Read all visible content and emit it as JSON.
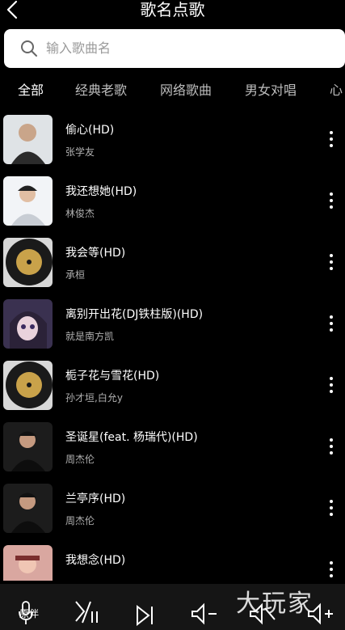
{
  "header": {
    "title": "歌名点歌"
  },
  "search": {
    "placeholder": "输入歌曲名"
  },
  "tabs": [
    {
      "label": "全部"
    },
    {
      "label": "经典老歌"
    },
    {
      "label": "网络歌曲"
    },
    {
      "label": "男女对唱"
    },
    {
      "label": "心"
    }
  ],
  "songs": [
    {
      "title": "偷心(HD)",
      "artist": "张学友",
      "thumb": "portrait-icon"
    },
    {
      "title": "我还想她(HD)",
      "artist": "林俊杰",
      "thumb": "portrait-icon"
    },
    {
      "title": "我会等(HD)",
      "artist": "承桓",
      "thumb": "vinyl-record-icon"
    },
    {
      "title": "离别开出花(DJ铁柱版)(HD)",
      "artist": "就是南方凯",
      "thumb": "anime-portrait-icon"
    },
    {
      "title": "栀子花与雪花(HD)",
      "artist": "孙才垣,白允y",
      "thumb": "vinyl-record-icon"
    },
    {
      "title": "圣诞星(feat. 杨瑞代)(HD)",
      "artist": "周杰伦",
      "thumb": "portrait-icon"
    },
    {
      "title": "兰亭序(HD)",
      "artist": "周杰伦",
      "thumb": "portrait-icon"
    },
    {
      "title": "我想念(HD)",
      "artist": "",
      "thumb": "portrait-icon"
    }
  ],
  "controls": {
    "original_accompany_label": "原伴",
    "watermark": "大玩家"
  },
  "colors": {
    "background": "#000000",
    "search_bg": "#ffffff",
    "muted_text": "#b0b0b0"
  }
}
